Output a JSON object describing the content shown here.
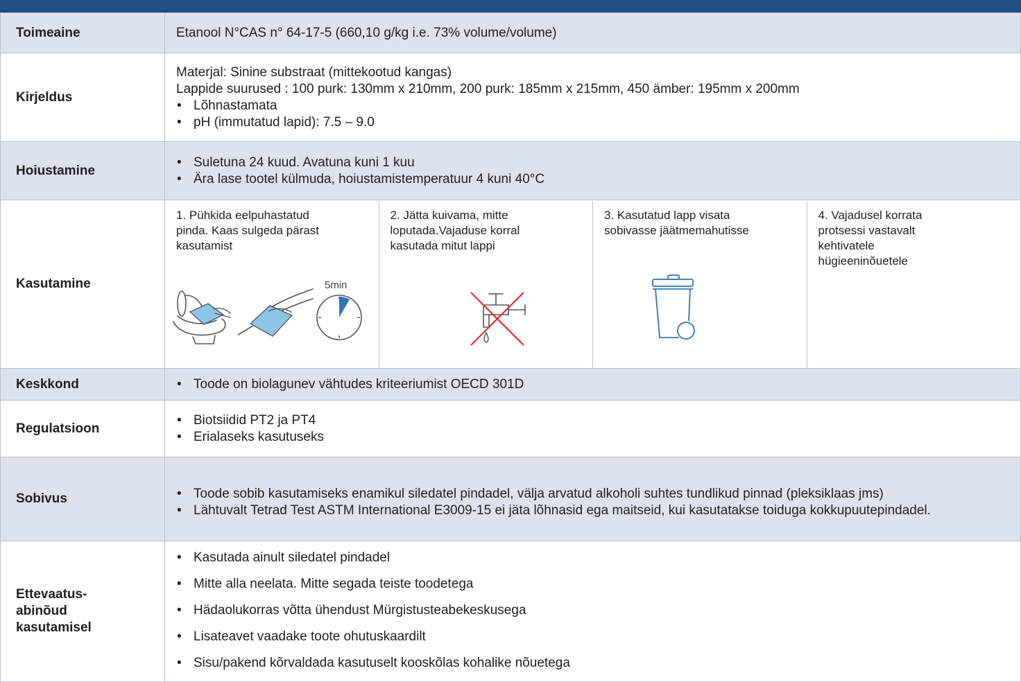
{
  "colors": {
    "header_band": "#1f4e86",
    "row_shade": "#dde3ee",
    "icon_blue": "#2e75b6",
    "cross_red": "#e32c2c"
  },
  "rows": {
    "toimeaine": {
      "label": "Toimeaine",
      "text": "Etanool N°CAS n° 64-17-5 (660,10 g/kg i.e. 73% volume/volume)"
    },
    "kirjeldus": {
      "label": "Kirjeldus",
      "lines": [
        "Materjal: Sinine substraat (mittekootud kangas)",
        "Lappide suurused : 100 purk: 130mm x 210mm, 200 purk: 185mm x 215mm, 450 ämber: 195mm x 200mm"
      ],
      "bullets": [
        "Lõhnastamata",
        "pH (immutatud lapid): 7.5 – 9.0"
      ]
    },
    "hoiustamine": {
      "label": "Hoiustamine",
      "bullets": [
        "Suletuna 24 kuud. Avatuna kuni 1 kuu",
        "Ära lase tootel külmuda, hoiustamistemperatuur 4 kuni 40°C"
      ]
    },
    "kasutamine": {
      "label": "Kasutamine",
      "steps": [
        {
          "text": "1. Pühkida eelpuhastatud pinda. Kaas sulgeda pärast kasutamist",
          "icons": [
            "toilet-wipe-icon",
            "hand-wipe-icon",
            "timer-icon"
          ],
          "timer_label": "5min"
        },
        {
          "text": "2. Jätta kuivama, mitte loputada.Vajaduse korral kasutada mitut lappi",
          "icons": [
            "no-rinse-tap-icon"
          ]
        },
        {
          "text": "3. Kasutatud lapp visata sobivasse jäätmemahutisse",
          "icons": [
            "waste-bin-icon"
          ]
        },
        {
          "text": "4. Vajadusel korrata protsessi vastavalt kehtivatele hügieeninõuetele",
          "icons": []
        }
      ]
    },
    "keskkond": {
      "label": "Keskkond",
      "bullets": [
        "Toode on biolagunev vähtudes kriteeriumist OECD 301D"
      ]
    },
    "regulatsioon": {
      "label": "Regulatsioon",
      "bullets": [
        "Biotsiidid PT2 ja PT4",
        "Erialaseks kasutuseks"
      ]
    },
    "sobivus": {
      "label": "Sobivus",
      "bullets": [
        "Toode sobib kasutamiseks enamikul siledatel pindadel, välja arvatud alkoholi suhtes tundlikud pinnad (pleksiklaas jms)",
        "Lähtuvalt Tetrad Test ASTM International E3009-15 ei jäta lõhnasid ega maitseid, kui kasutatakse toiduga kokkupuutepindadel."
      ]
    },
    "ettevaatus": {
      "label_lines": [
        "Ettevaatus-",
        "abinõud",
        "kasutamisel"
      ],
      "bullets": [
        "Kasutada ainult siledatel pindadel",
        "Mitte alla neelata. Mitte segada teiste toodetega",
        "Hädaolukorras võtta ühendust Mürgistusteabekeskusega",
        "Lisateavet vaadake toote ohutuskaardilt",
        "Sisu/pakend kõrvaldada kasutuselt kooskõlas kohalike nõuetega"
      ]
    }
  }
}
